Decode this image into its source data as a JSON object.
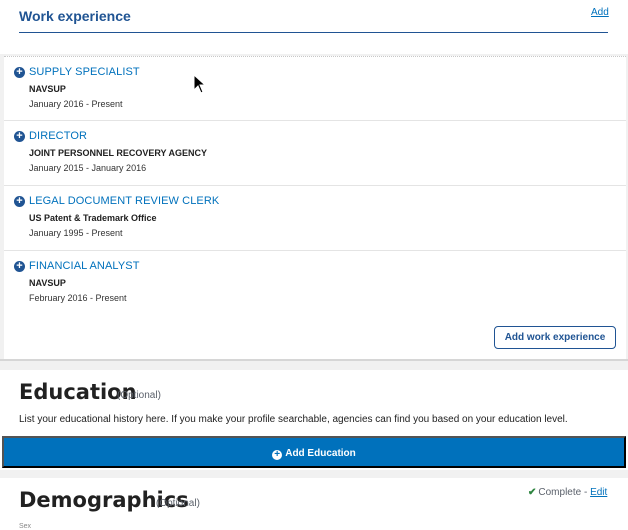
{
  "work_experience": {
    "title": "Work experience",
    "add_link": "Add",
    "jobs": [
      {
        "title": "SUPPLY SPECIALIST",
        "org": "NAVSUP",
        "dates": "January 2016 - Present"
      },
      {
        "title": "DIRECTOR",
        "org": "JOINT PERSONNEL RECOVERY AGENCY",
        "dates": "January 2015 - January 2016"
      },
      {
        "title": "LEGAL DOCUMENT REVIEW CLERK",
        "org": "US Patent & Trademark Office",
        "dates": "January 1995 - Present"
      },
      {
        "title": "FINANCIAL ANALYST",
        "org": "NAVSUP",
        "dates": "February 2016 - Present"
      }
    ],
    "add_button": "Add work experience"
  },
  "education": {
    "title": "Education",
    "optional": "(Optional)",
    "description": "List your educational history here. If you make your profile searchable, agencies can find you based on your education level.",
    "add_button": "Add Education"
  },
  "demographics": {
    "title": "Demographics",
    "optional": "(Optional)",
    "status": "Complete -",
    "edit_link": "Edit",
    "sub_label": "Sex"
  },
  "icons": {
    "plus": "plus-circle-icon",
    "check": "checkmark-icon",
    "cursor": "mouse-pointer-icon"
  },
  "colors": {
    "primary_blue": "#0071bc",
    "dark_blue": "#205493",
    "success_green": "#2e8540"
  }
}
